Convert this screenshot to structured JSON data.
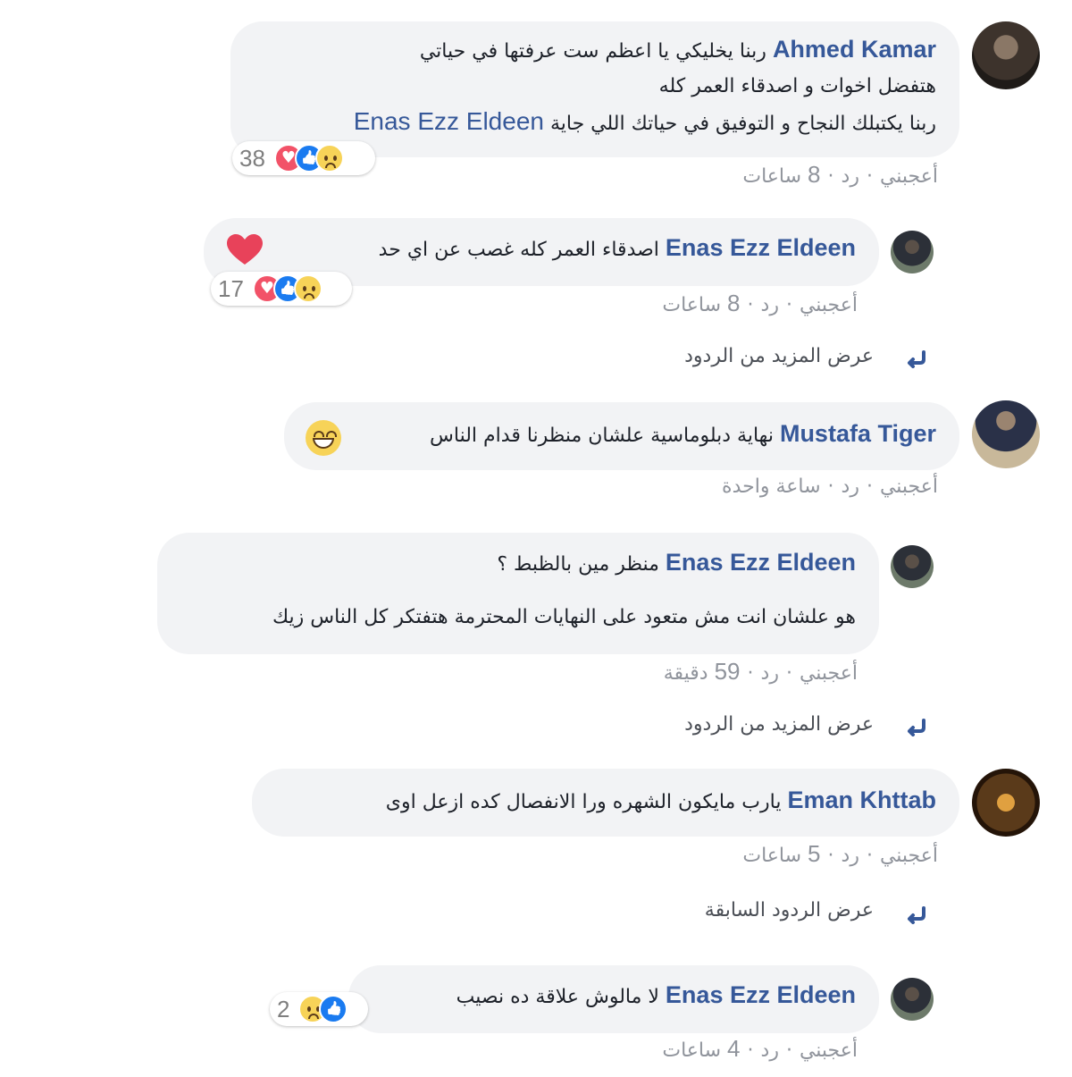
{
  "labels": {
    "like": "أعجبني",
    "reply": "رد",
    "dot": "·"
  },
  "comments": [
    {
      "author": "Ahmed Kamar",
      "lines": [
        "ربنا يخليكي يا اعظم ست عرفتها في حياتي",
        "هتفضل اخوات و اصدقاء العمر كله",
        "ربنا يكتبلك النجاح و التوفيق في حياتك اللي جاية"
      ],
      "mention": "Enas Ezz Eldeen",
      "reactions": {
        "count": "38",
        "types": [
          "love",
          "like",
          "sad"
        ]
      },
      "time_num": "8",
      "time_unit": "ساعات"
    },
    {
      "author": "Enas Ezz Eldeen",
      "lines": [
        "اصدقاء العمر كله غصب عن اي حد"
      ],
      "emoji": "heart",
      "reactions": {
        "count": "17",
        "types": [
          "love",
          "like",
          "sad"
        ]
      },
      "time_num": "8",
      "time_unit": "ساعات",
      "more_replies": "عرض المزيد من الردود"
    },
    {
      "author": "Mustafa Tiger",
      "lines": [
        "نهاية دبلوماسية علشان منظرنا قدام الناس"
      ],
      "emoji": "smile",
      "time_text": "ساعة واحدة"
    },
    {
      "author": "Enas Ezz Eldeen",
      "lines": [
        "منظر مين بالظبط ؟",
        "هو علشان انت مش متعود على النهايات المحترمة هتفتكر كل الناس زيك"
      ],
      "time_num": "59",
      "time_unit": "دقيقة",
      "more_replies": "عرض المزيد من الردود"
    },
    {
      "author": "Eman Khttab",
      "lines": [
        "يارب مايكون الشهره ورا الانفصال كده ازعل اوى"
      ],
      "time_num": "5",
      "time_unit": "ساعات",
      "more_replies": "عرض الردود السابقة"
    },
    {
      "author": "Enas Ezz Eldeen",
      "lines": [
        "لا مالوش علاقة ده نصيب"
      ],
      "reactions": {
        "count": "2",
        "types": [
          "like",
          "sad"
        ]
      },
      "time_num": "4",
      "time_unit": "ساعات"
    }
  ]
}
